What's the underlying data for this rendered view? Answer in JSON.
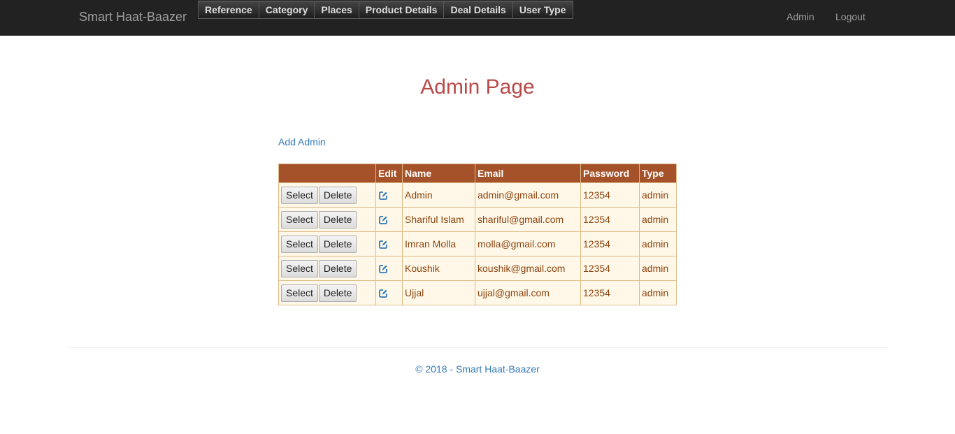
{
  "brand": "Smart Haat-Baazer",
  "menu": [
    {
      "label": "Reference"
    },
    {
      "label": "Category"
    },
    {
      "label": "Places"
    },
    {
      "label": "Product Details"
    },
    {
      "label": "Deal Details"
    },
    {
      "label": "User Type"
    }
  ],
  "nav_right": {
    "admin": "Admin",
    "logout": "Logout"
  },
  "page_title": "Admin Page",
  "add_admin_link": "Add Admin",
  "grid": {
    "headers": {
      "actions": "",
      "edit": "Edit",
      "name": "Name",
      "email": "Email",
      "password": "Password",
      "type": "Type"
    },
    "select_label": "Select",
    "delete_label": "Delete",
    "rows": [
      {
        "name": "Admin",
        "email": "admin@gmail.com",
        "password": "12354",
        "type": "admin"
      },
      {
        "name": "Shariful Islam",
        "email": "shariful@gmail.com",
        "password": "12354",
        "type": "admin"
      },
      {
        "name": "Imran Molla",
        "email": "molla@gmail.com",
        "password": "12354",
        "type": "admin"
      },
      {
        "name": "Koushik",
        "email": "koushik@gmail.com",
        "password": "12354",
        "type": "admin"
      },
      {
        "name": "Ujjal",
        "email": "ujjal@gmail.com",
        "password": "12354",
        "type": "admin"
      }
    ]
  },
  "footer": "© 2018 - Smart Haat-Baazer",
  "colors": {
    "navbar_bg": "#222222",
    "title": "#b94a48",
    "link": "#337ab7",
    "grid_header_bg": "#a55129",
    "grid_row_bg": "#fff7e7",
    "grid_row_text": "#8c4510",
    "grid_border": "#deba84"
  },
  "icons": {
    "edit": "edit-pencil-square-icon"
  }
}
